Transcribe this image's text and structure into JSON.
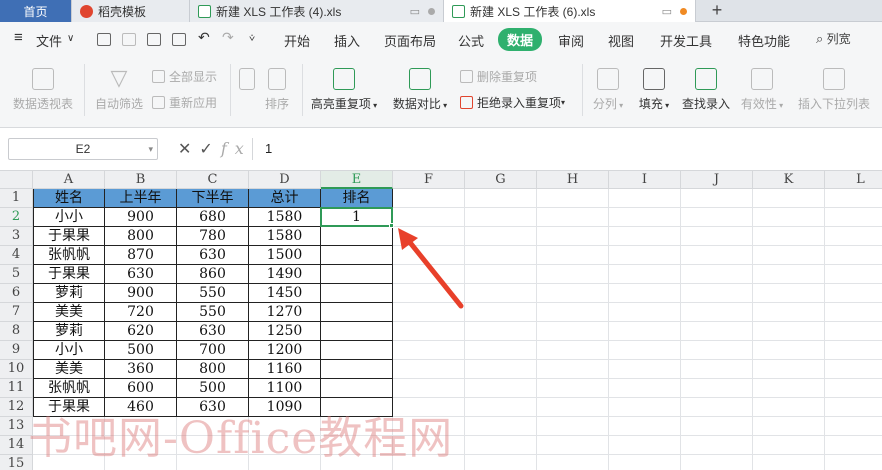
{
  "tabs": [
    {
      "label": "首页",
      "icon": ""
    },
    {
      "label": "稻壳模板",
      "icon": "fire-icon"
    },
    {
      "label": "新建 XLS 工作表 (4).xls",
      "icon": "xls-icon"
    },
    {
      "label": "新建 XLS 工作表 (6).xls",
      "icon": "xls-icon"
    }
  ],
  "menu": {
    "file": "文件",
    "items": [
      "开始",
      "插入",
      "页面布局",
      "公式",
      "数据",
      "审阅",
      "视图",
      "开发工具",
      "特色功能"
    ],
    "active": "数据",
    "search": "列宽"
  },
  "ribbon": {
    "pivot": "数据透视表",
    "autofilter": "自动筛选",
    "showall": "全部显示",
    "reapply": "重新应用",
    "sort": "排序",
    "highlight_dup": "高亮重复项",
    "compare": "数据对比",
    "remove_dup": "删除重复项",
    "reject_dup": "拒绝录入重复项",
    "split": "分列",
    "fill": "填充",
    "lookup": "查找录入",
    "validity": "有效性",
    "insert_dropdown": "插入下拉列表"
  },
  "formula_bar": {
    "namebox": "E2",
    "value": "1"
  },
  "columns": [
    "A",
    "B",
    "C",
    "D",
    "E",
    "F",
    "G",
    "H",
    "I",
    "J",
    "K",
    "L"
  ],
  "rows": [
    "1",
    "2",
    "3",
    "4",
    "5",
    "6",
    "7",
    "8",
    "9",
    "10",
    "11",
    "12",
    "13",
    "14",
    "15"
  ],
  "table": {
    "headers": [
      "姓名",
      "上半年",
      "下半年",
      "总计",
      "排名"
    ],
    "rows": [
      [
        "小小",
        "900",
        "680",
        "1580",
        "1"
      ],
      [
        "于果果",
        "800",
        "780",
        "1580",
        ""
      ],
      [
        "张帆帆",
        "870",
        "630",
        "1500",
        ""
      ],
      [
        "于果果",
        "630",
        "860",
        "1490",
        ""
      ],
      [
        "萝莉",
        "900",
        "550",
        "1450",
        ""
      ],
      [
        "美美",
        "720",
        "550",
        "1270",
        ""
      ],
      [
        "萝莉",
        "620",
        "630",
        "1250",
        ""
      ],
      [
        "小小",
        "500",
        "700",
        "1200",
        ""
      ],
      [
        "美美",
        "360",
        "800",
        "1160",
        ""
      ],
      [
        "张帆帆",
        "600",
        "500",
        "1100",
        ""
      ],
      [
        "于果果",
        "460",
        "630",
        "1090",
        ""
      ]
    ]
  },
  "watermark": "书吧网-Office教程网",
  "colors": {
    "accent": "#2fb06e",
    "header_fill": "#5b9bd5",
    "annotation_arrow": "#e8402a"
  }
}
